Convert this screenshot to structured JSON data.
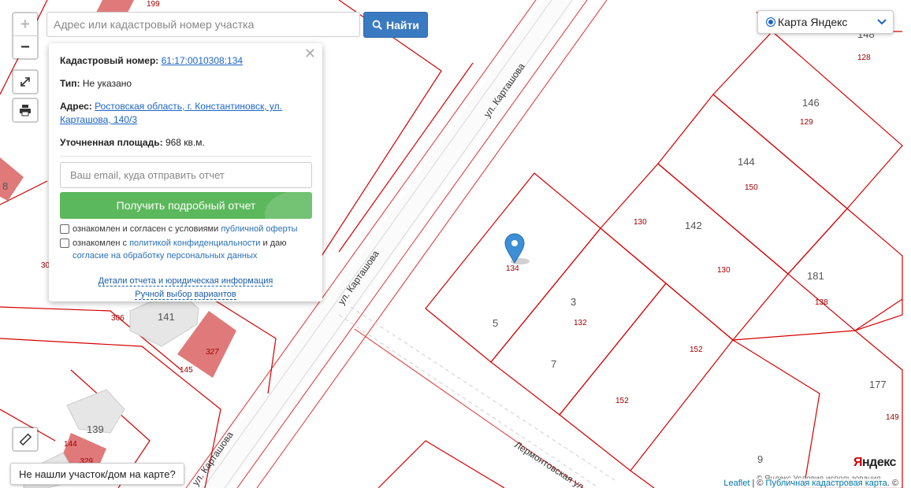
{
  "search": {
    "placeholder": "Адрес или кадастровый номер участка",
    "button_label": "Найти"
  },
  "zoom": {
    "in_label": "+",
    "out_label": "−"
  },
  "layer_select": {
    "selected": "Карта Яндекс"
  },
  "popup": {
    "cadastral_label": "Кадастровый номер:",
    "cadastral_value": "61:17:0010308:134",
    "type_label": "Тип:",
    "type_value": "Не указано",
    "address_label": "Адрес:",
    "address_value": "Ростовская область, г. Константиновск, ул. Карташова, 140/3",
    "area_label": "Уточненная площадь:",
    "area_value": "968 кв.м.",
    "email_placeholder": "Ваш email, куда отправить отчет",
    "report_button": "Получить подробный отчет",
    "consent1_text": "ознакомлен и согласен с условиями",
    "consent1_link": "публичной оферты",
    "consent2_text1": "ознакомлен с",
    "consent2_link1": "политикой конфиденциальности",
    "consent2_text2": "и даю",
    "consent2_link2": "согласие на обработку персональных данных",
    "details_link": "Детали отчета и юридическая информация",
    "manual_link": "Ручной выбор вариантов"
  },
  "not_found_button": "Не нашли участок/дом на карте?",
  "attribution": {
    "leaflet": "Leaflet",
    "separator": " | © ",
    "pkk": "Публичная кадастровая карта",
    "tail": ". ©"
  },
  "yandex": {
    "logo_y": "Я",
    "logo_rest": "ндекс",
    "copyright": "© Яндекс Условия использования"
  },
  "map_labels": {
    "streets": [
      "ул. Карташова",
      "ул. Карташова",
      "ул. Карташова",
      "Лермонтовская ул."
    ],
    "house_numbers": [
      "146",
      "144",
      "142",
      "181",
      "177",
      "3",
      "5",
      "7",
      "9",
      "141",
      "139",
      "148",
      "8"
    ],
    "parcel_numbers": [
      "199",
      "128",
      "129",
      "150",
      "130",
      "130",
      "138",
      "134",
      "132",
      "152",
      "152",
      "149",
      "306",
      "327",
      "145",
      "144",
      "329",
      "30"
    ]
  },
  "colors": {
    "parcel_border": "#d40000",
    "building_red": "#e07a7a",
    "building_gray": "#e6e6e6",
    "button_blue": "#3a7ac0",
    "button_green": "#5cb85c",
    "marker_blue": "#3d8fd6"
  }
}
